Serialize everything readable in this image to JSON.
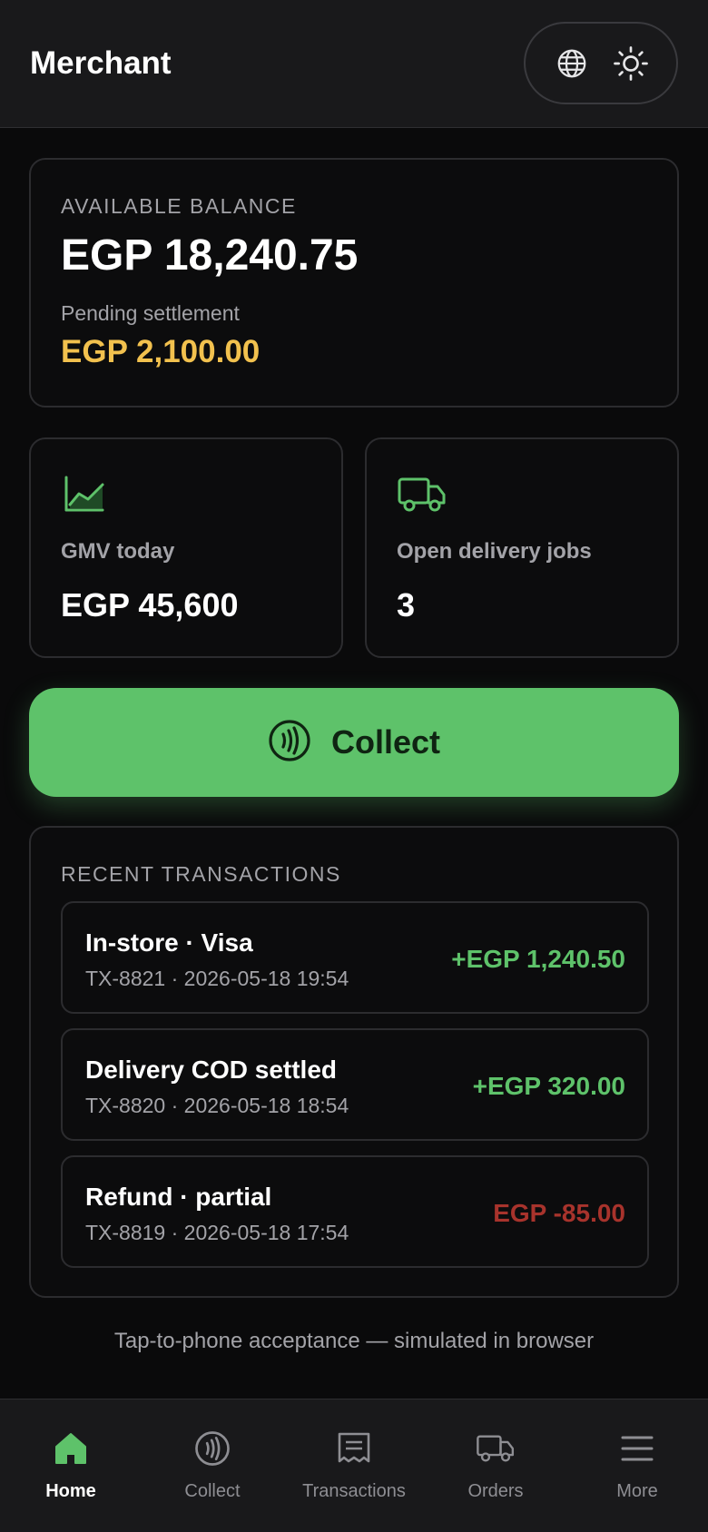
{
  "header": {
    "title": "Merchant",
    "language_icon": "globe-icon",
    "theme_icon": "sun-icon"
  },
  "balance": {
    "label": "AVAILABLE BALANCE",
    "value": "EGP 18,240.75",
    "pending_label": "Pending settlement",
    "pending_value": "EGP 2,100.00"
  },
  "stats": {
    "gmv": {
      "icon": "chart-line-icon",
      "label": "GMV today",
      "value": "EGP 45,600"
    },
    "delivery": {
      "icon": "truck-icon",
      "label": "Open delivery jobs",
      "value": "3"
    }
  },
  "collect": {
    "label": "Collect",
    "icon": "contactless-icon"
  },
  "transactions": {
    "title": "RECENT TRANSACTIONS",
    "items": [
      {
        "name": "In-store · Visa",
        "meta": "TX-8821 · 2026-05-18 19:54",
        "amount": "+EGP 1,240.50"
      },
      {
        "name": "Delivery COD settled",
        "meta": "TX-8820 · 2026-05-18 18:54",
        "amount": "+EGP 320.00"
      },
      {
        "name": "Refund · partial",
        "meta": "TX-8819 · 2026-05-18 17:54",
        "amount": "EGP -85.00"
      }
    ]
  },
  "footer_note": "Tap-to-phone acceptance — simulated in browser",
  "nav": {
    "items": [
      {
        "label": "Home",
        "icon": "home-icon"
      },
      {
        "label": "Collect",
        "icon": "contactless-icon"
      },
      {
        "label": "Transactions",
        "icon": "receipt-icon"
      },
      {
        "label": "Orders",
        "icon": "truck-icon"
      },
      {
        "label": "More",
        "icon": "menu-icon"
      }
    ]
  },
  "colors": {
    "accent": "#5ec26a",
    "pending": "#f2c14e",
    "negative": "#a8332c",
    "background": "#0a0a0b"
  }
}
